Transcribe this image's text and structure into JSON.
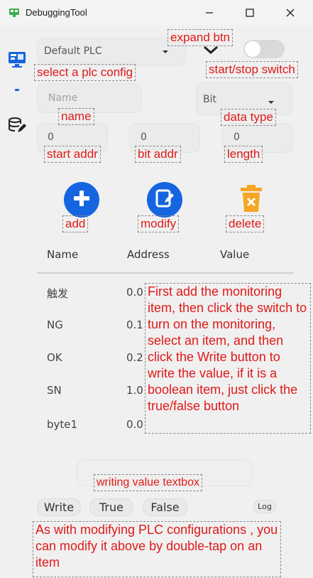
{
  "window": {
    "title": "DebuggingTool",
    "minimize_glyph": "—",
    "maximize_glyph": "☐",
    "close_glyph": "✕"
  },
  "sidebar": {
    "items": [
      {
        "icon": "monitor-icon",
        "active": true
      },
      {
        "icon": "database-edit-icon",
        "active": false
      }
    ],
    "active_indicator": "-"
  },
  "config": {
    "plc_select_value": "Default PLC",
    "name_placeholder": "Name",
    "data_type_value": "Bit",
    "start_addr_value": "0",
    "bit_addr_value": "0",
    "length_value": "0"
  },
  "actions": {
    "add_icon": "plus-icon",
    "modify_icon": "edit-icon",
    "delete_icon": "trash-icon"
  },
  "table": {
    "headers": [
      "Name",
      "Address",
      "Value"
    ],
    "rows": [
      {
        "name": "触发",
        "address": "0.0"
      },
      {
        "name": "NG",
        "address": "0.1"
      },
      {
        "name": "OK",
        "address": "0.2"
      },
      {
        "name": "SN",
        "address": "1.0"
      },
      {
        "name": "byte1",
        "address": "0.0"
      }
    ]
  },
  "bottom": {
    "write_label": "Write",
    "true_label": "True",
    "false_label": "False",
    "log_label": "Log"
  },
  "annotations": {
    "expand_btn": "expand btn",
    "select_plc_config": "select a plc config",
    "start_stop_switch": "start/stop switch",
    "name": "name",
    "data_type": "data type",
    "start_addr": "start addr",
    "bit_addr": "bit addr",
    "length": "length",
    "add": "add",
    "modify": "modify",
    "delete": "delete",
    "instructions": "First add the monitoring item, then click the switch to turn on the monitoring, select an item, and then click the Write button to write the value, if it is a boolean item, just click the true/false button",
    "writing_value_textbox": "writing value textbox",
    "double_tap_note": "As with modifying PLC configurations , you can modify it above by double-tap on an item"
  },
  "colors": {
    "accent_blue": "#1565e0",
    "delete_orange": "#f5a623",
    "annotation_red": "#e01919"
  }
}
